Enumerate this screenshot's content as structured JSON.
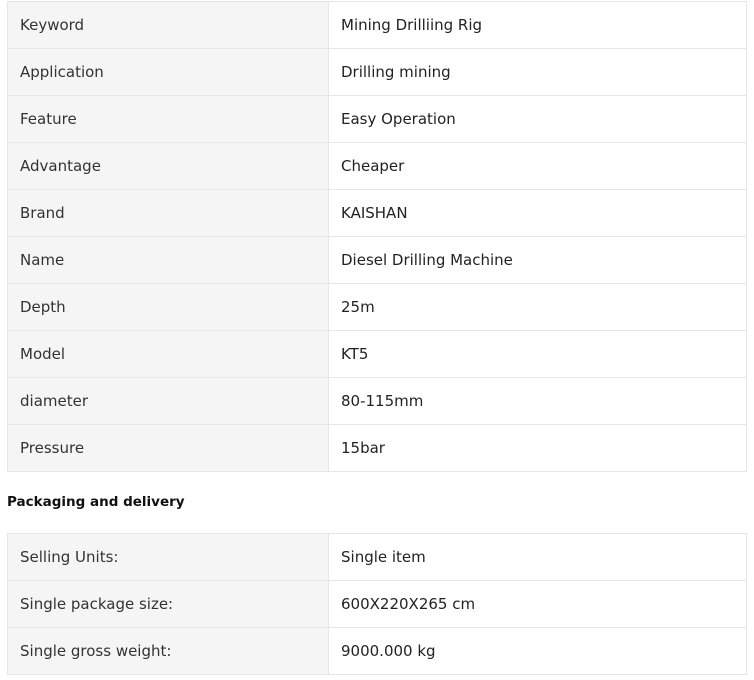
{
  "specs": [
    {
      "key": "Keyword",
      "value": "Mining Drilliing Rig"
    },
    {
      "key": "Application",
      "value": "Drilling mining"
    },
    {
      "key": "Feature",
      "value": "Easy Operation"
    },
    {
      "key": "Advantage",
      "value": "Cheaper"
    },
    {
      "key": "Brand",
      "value": "KAISHAN"
    },
    {
      "key": "Name",
      "value": "Diesel Drilling Machine"
    },
    {
      "key": "Depth",
      "value": "25m"
    },
    {
      "key": "Model",
      "value": "KT5"
    },
    {
      "key": "diameter",
      "value": "80-115mm"
    },
    {
      "key": "Pressure",
      "value": "15bar"
    }
  ],
  "packaging": {
    "title": "Packaging and delivery",
    "rows": [
      {
        "key": "Selling Units:",
        "value": "Single item"
      },
      {
        "key": "Single package size:",
        "value": "600X220X265 cm"
      },
      {
        "key": "Single gross weight:",
        "value": "9000.000 kg"
      }
    ]
  }
}
